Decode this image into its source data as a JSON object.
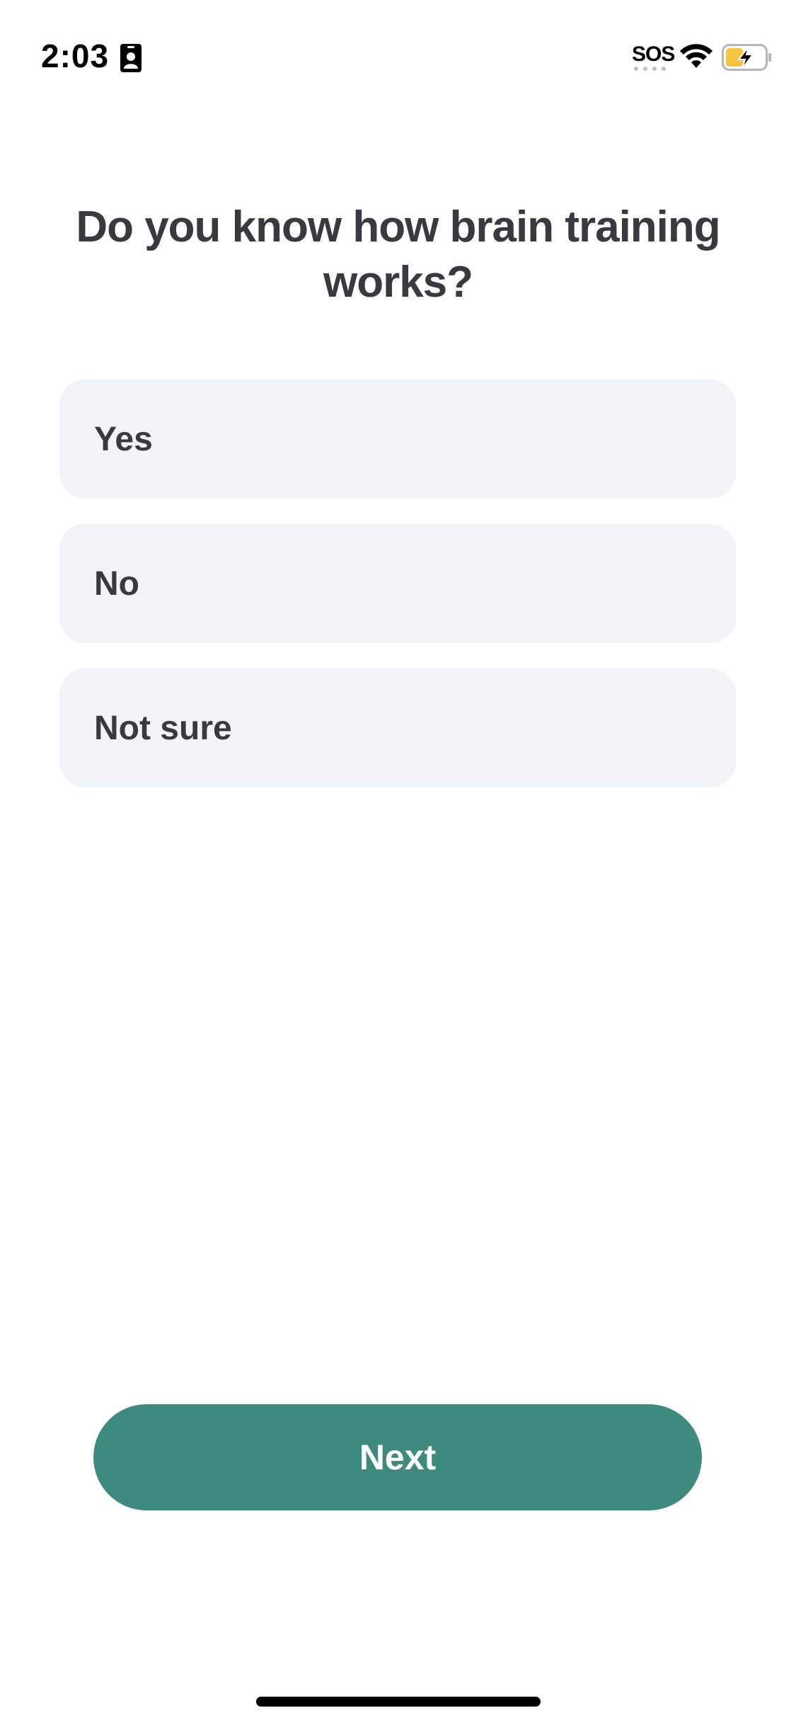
{
  "status_bar": {
    "time": "2:03",
    "sos_label": "SOS",
    "icons": [
      "id-card-icon",
      "wifi-icon",
      "battery-charging-icon"
    ]
  },
  "question": {
    "title": "Do you know how brain training works?"
  },
  "options": [
    {
      "label": "Yes"
    },
    {
      "label": "No"
    },
    {
      "label": "Not sure"
    }
  ],
  "next_button": {
    "label": "Next"
  },
  "colors": {
    "background": "#ffffff",
    "option_background": "#f2f3f7",
    "text": "#393a40",
    "accent": "#3e8a7e",
    "battery_fill": "#f5c542"
  }
}
